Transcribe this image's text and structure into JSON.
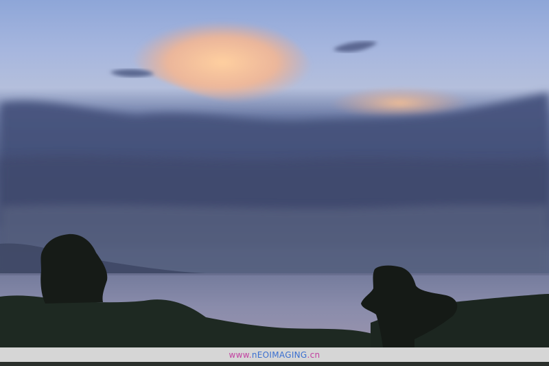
{
  "scene": {
    "subject": "sunset-over-sea-with-rock-formations",
    "colors": {
      "sky_top": "#8aa6d6",
      "sky_mid": "#a9b9de",
      "cloud_glow": "#ffc28f",
      "cloud_dark": "#4b5a82",
      "sea": "#7f83a6",
      "foreground": "#1c2620"
    }
  },
  "watermark": {
    "part_a": "www.",
    "part_b": "nEOIMAGING",
    "part_c": ".cn"
  }
}
